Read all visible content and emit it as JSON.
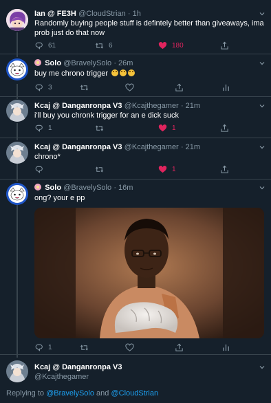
{
  "colors": {
    "background": "#15202b",
    "text_primary": "#ffffff",
    "text_secondary": "#8899a6",
    "like_active": "#e0245e",
    "link": "#1da1f2",
    "border": "#38444d"
  },
  "tweets": [
    {
      "name": "Ian @ FE3H",
      "handle": "@CloudStrian",
      "time": "· 1h",
      "text": "Randomly buying people stuff is defintely better than giveaways, ima prob just do that now",
      "replies": "61",
      "retweets": "6",
      "likes": "180",
      "liked": true
    },
    {
      "name": "Solo",
      "handle": "@BravelySolo",
      "time": "· 26m",
      "text": "buy me chrono trigger",
      "emojis": [
        "smiling-cat-emoji",
        "smiling-cat-emoji",
        "smiling-cat-emoji"
      ],
      "replies": "3",
      "retweets": "",
      "likes": "",
      "liked": false
    },
    {
      "name": "Kcaj @ Danganronpa V3",
      "handle": "@Kcajthegamer",
      "time": "· 21m",
      "text": "i'll buy you chronk trigger for an e dick suck",
      "replies": "1",
      "retweets": "",
      "likes": "1",
      "liked": true
    },
    {
      "name": "Kcaj @ Danganronpa V3",
      "handle": "@Kcajthegamer",
      "time": "· 21m",
      "text": "chrono*",
      "replies": "",
      "retweets": "",
      "likes": "1",
      "liked": true
    },
    {
      "name": "Solo",
      "handle": "@BravelySolo",
      "time": "· 16m",
      "text": "ong? your e pp",
      "replies": "1",
      "retweets": "",
      "likes": "",
      "liked": false
    }
  ],
  "compose": {
    "name": "Kcaj @ Danganronpa V3",
    "handle": "@Kcajthegamer",
    "replying_prefix": "Replying to",
    "mention_1": "@BravelySolo",
    "conjunction": "and",
    "mention_2": "@CloudStrian"
  },
  "icons": {
    "reply": "reply-icon",
    "retweet": "retweet-icon",
    "like": "heart-icon",
    "share": "share-icon",
    "analytics": "analytics-icon",
    "more": "chevron-down-icon"
  }
}
